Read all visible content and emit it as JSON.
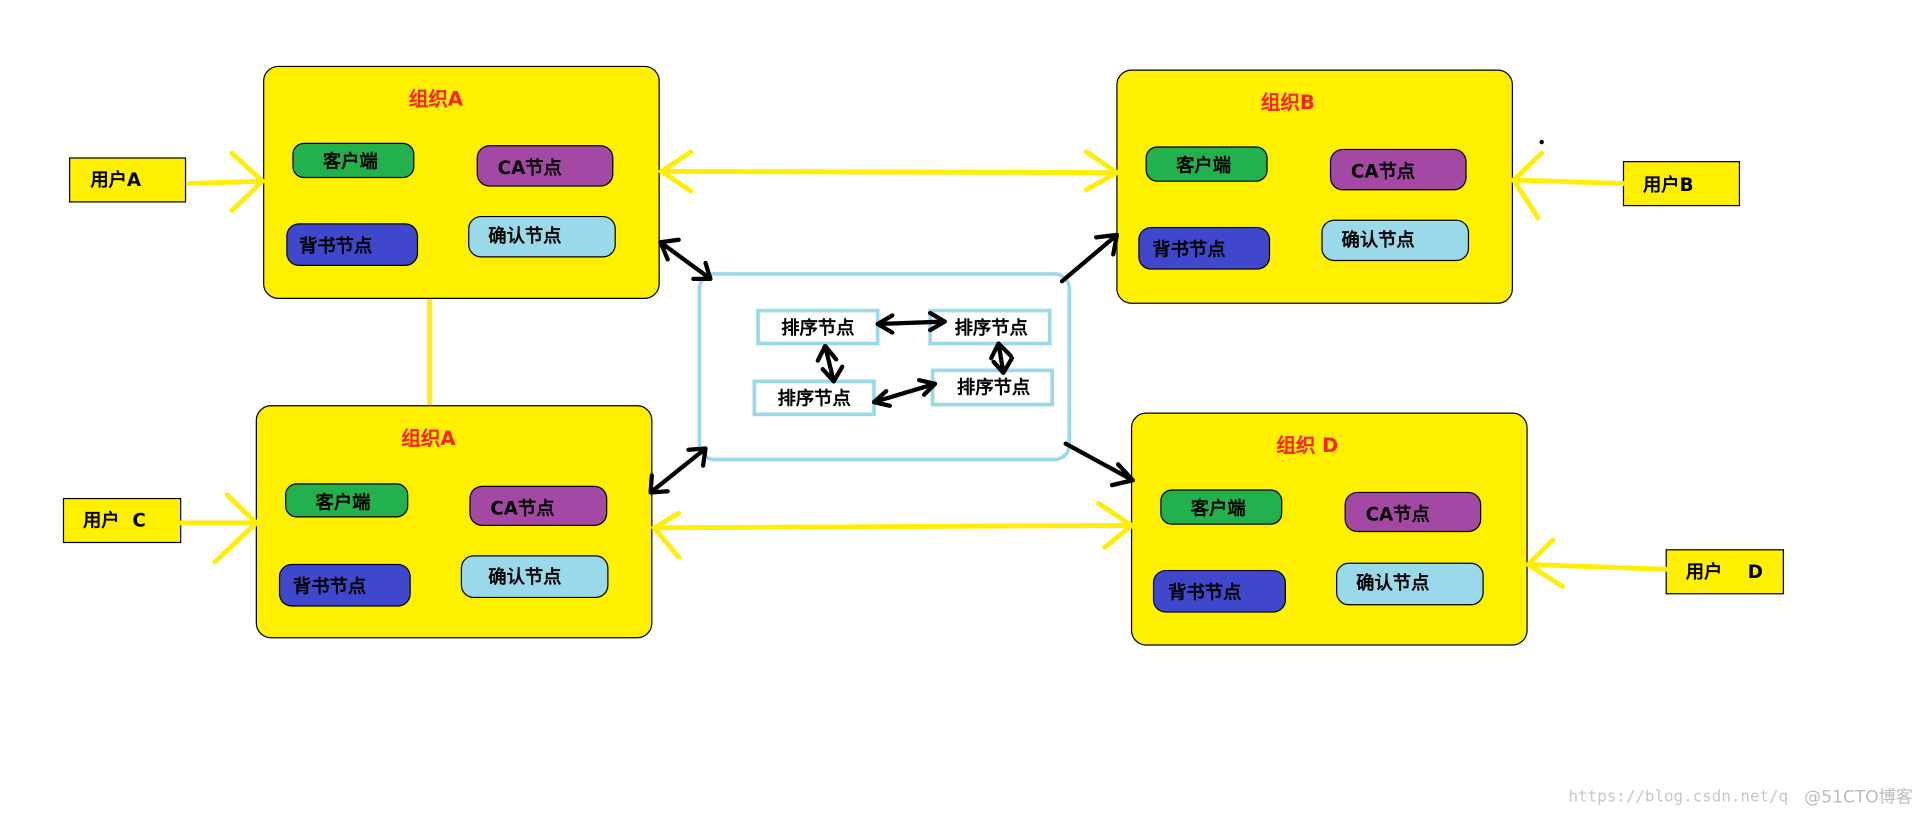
{
  "colors": {
    "org_box": "#fff000",
    "title": "#ff2020",
    "client": "#22b14c",
    "ca": "#a349a4",
    "endorser": "#3f48cc",
    "committer": "#99d9ea",
    "orderer_border": "#99d9ea",
    "arrow_yellow": "#ffee00",
    "arrow_black": "#000000"
  },
  "orgs": [
    {
      "title": "组织A",
      "client": "客户端",
      "ca": "CA节点",
      "endorser": "背书节点",
      "committer": "确认节点"
    },
    {
      "title": "组织A",
      "client": "客户端",
      "ca": "CA节点",
      "endorser": "背书节点",
      "committer": "确认节点"
    },
    {
      "title": "组织B",
      "client": "客户端",
      "ca": "CA节点",
      "endorser": "背书节点",
      "committer": "确认节点"
    },
    {
      "title": "组织 D",
      "client": "客户端",
      "ca": "CA节点",
      "endorser": "背书节点",
      "committer": "确认节点"
    }
  ],
  "users": [
    "用户A",
    "用户  C",
    "用户B",
    "用户    D"
  ],
  "orderers": [
    "排序节点",
    "排序节点",
    "排序节点",
    "排序节点"
  ],
  "watermark": {
    "url": "https://blog.csdn.net/q",
    "brand": "@51CTO博客"
  }
}
